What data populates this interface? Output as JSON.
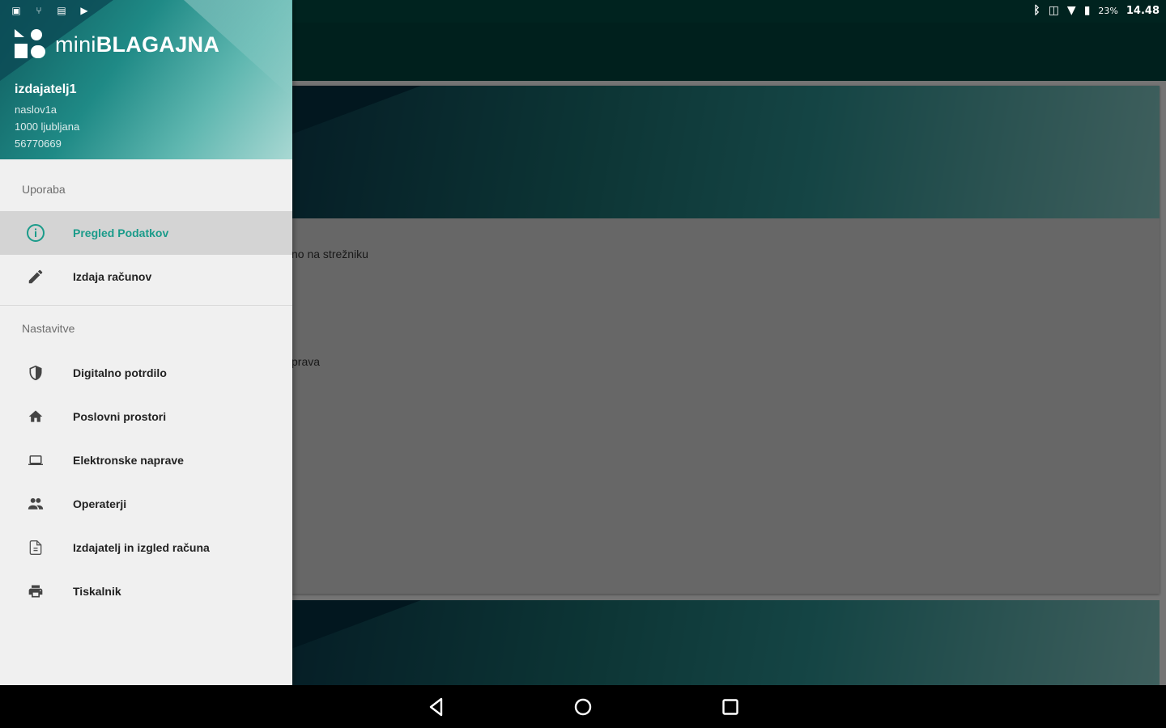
{
  "status_bar": {
    "left_icons": [
      "screenshot-icon",
      "usb-icon",
      "briefcase-icon",
      "youtube-icon"
    ],
    "right_icons": [
      "bluetooth-icon",
      "vibrate-icon",
      "wifi-icon",
      "battery-icon"
    ],
    "battery": "23%",
    "time": "14.48"
  },
  "drawer": {
    "logo": {
      "light": "mini",
      "bold": "BLAGAJNA"
    },
    "issuer": {
      "name": "izdajatelj1",
      "address": "naslov1a",
      "city": "1000 ljubljana",
      "tax_number": "56770669"
    },
    "sections": [
      {
        "title": "Uporaba",
        "items": [
          {
            "label": "Pregled Podatkov",
            "icon": "info-icon",
            "active": true
          },
          {
            "label": "Izdaja računov",
            "icon": "pencil-icon",
            "active": false
          }
        ]
      },
      {
        "title": "Nastavitve",
        "items": [
          {
            "label": "Digitalno potrdilo",
            "icon": "shield-icon"
          },
          {
            "label": "Poslovni prostori",
            "icon": "home-icon"
          },
          {
            "label": "Elektronske naprave",
            "icon": "laptop-icon"
          },
          {
            "label": "Operaterji",
            "icon": "people-icon"
          },
          {
            "label": "Izdajatelj in izgled računa",
            "icon": "document-icon"
          },
          {
            "label": "Tiskalnik",
            "icon": "printer-icon"
          }
        ]
      }
    ]
  },
  "content": {
    "text_1": "no na strežniku",
    "text_2": "prava"
  },
  "colors": {
    "accent": "#1a9b8a",
    "toolbar": "#00403a",
    "status_bar": "#00231f"
  }
}
